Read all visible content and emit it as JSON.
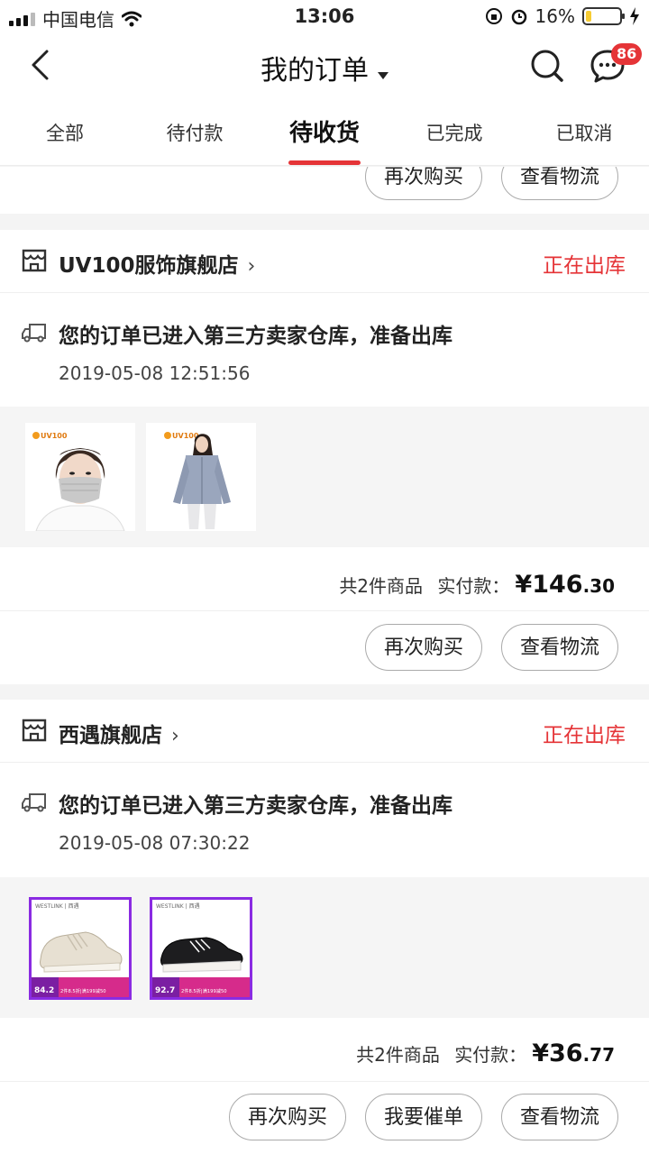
{
  "status_bar": {
    "carrier": "中国电信",
    "time": "13:06",
    "battery": "16%",
    "battery_level": 0.16
  },
  "header": {
    "title": "我的订单",
    "message_badge": "86"
  },
  "tabs": [
    {
      "label": "全部"
    },
    {
      "label": "待付款"
    },
    {
      "label": "待收货"
    },
    {
      "label": "已完成"
    },
    {
      "label": "已取消"
    }
  ],
  "active_tab": 2,
  "top_partial_card": {
    "buttons": [
      "再次购买",
      "查看物流"
    ]
  },
  "orders": [
    {
      "store_name": "UV100服饰旗舰店",
      "chevron": "›",
      "status": "正在出库",
      "log_text": "您的订单已进入第三方卖家仓库，准备出库",
      "log_time": "2019-05-08 12:51:56",
      "products": [
        {
          "brand": "UV100",
          "alt": "口罩"
        },
        {
          "brand": "UV100",
          "alt": "防晒衣"
        }
      ],
      "summary": "共2件商品",
      "paid_label": "实付款：",
      "price_int": "¥146",
      "price_dec": ".30",
      "buttons": [
        "再次购买",
        "查看物流"
      ]
    },
    {
      "store_name": "西遇旗舰店",
      "chevron": "›",
      "status": "正在出库",
      "log_text": "您的订单已进入第三方卖家仓库，准备出库",
      "log_time": "2019-05-08 07:30:22",
      "products": [
        {
          "brand": "WESTLINK | 西遇",
          "price": "84.2",
          "promo": "2件8.5折|满199减50"
        },
        {
          "brand": "WESTLINK | 西遇",
          "price": "92.7",
          "promo": "2件8.5折|满199减50"
        }
      ],
      "summary": "共2件商品",
      "paid_label": "实付款：",
      "price_int": "¥36",
      "price_dec": ".77",
      "buttons": [
        "再次购买",
        "我要催单",
        "查看物流"
      ]
    }
  ],
  "colors": {
    "accent": "#e53437",
    "battery_yellow": "#f7cc33",
    "promo_purple": "#8a2be2"
  }
}
